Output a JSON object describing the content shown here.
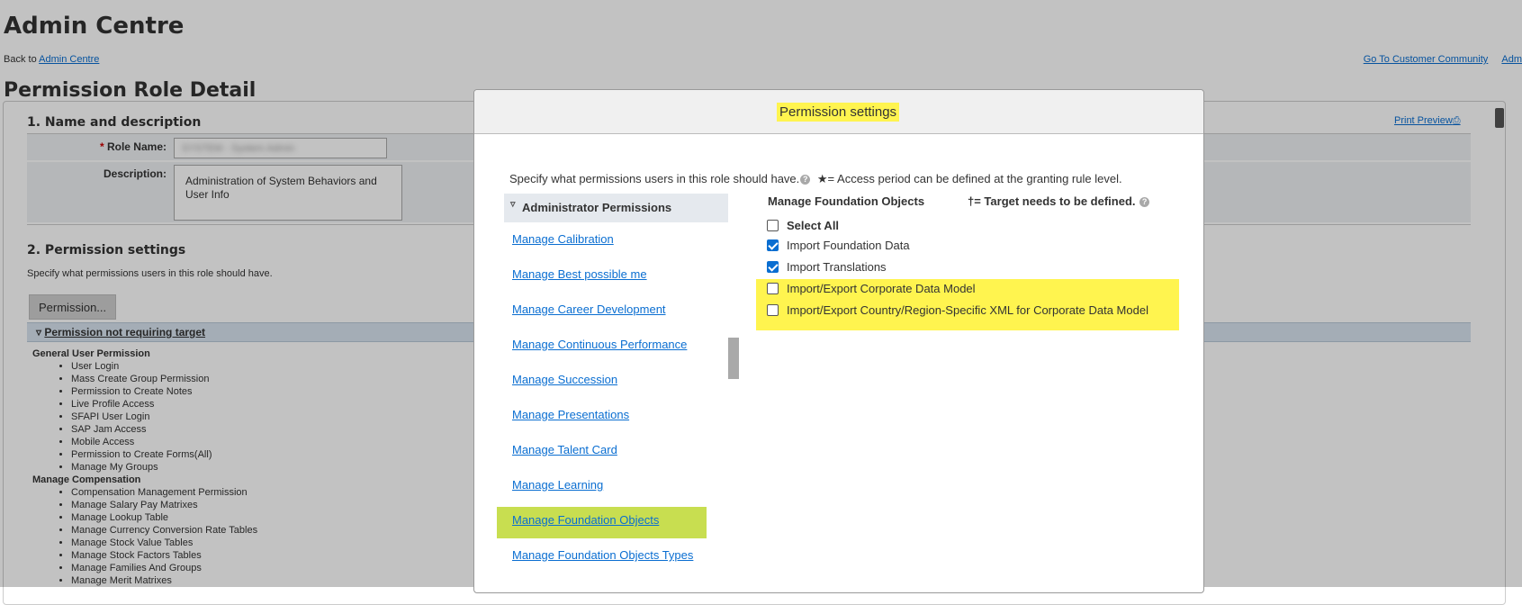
{
  "page": {
    "title": "Admin Centre",
    "back_prefix": "Back to",
    "back_link": "Admin Centre",
    "top_links": [
      "Go To Customer Community",
      "Adm"
    ],
    "detail_title": "Permission Role Detail",
    "print_preview": "Print Preview"
  },
  "section1": {
    "title": "1. Name and description",
    "role_name_label": "Role Name:",
    "role_name_value": "SYSTEM - System Admin",
    "description_label": "Description:",
    "description_value": "Administration of System Behaviors and User Info"
  },
  "section2": {
    "title": "2. Permission settings",
    "subtitle": "Specify what permissions users in this role should have.",
    "permission_button": "Permission...",
    "group_label": "Permission not requiring target",
    "categories": [
      {
        "name": "General User Permission",
        "items": [
          "User Login",
          "Mass Create Group Permission",
          "Permission to Create Notes",
          "Live Profile Access",
          "SFAPI User Login",
          "SAP Jam Access",
          "Mobile Access",
          "Permission to Create Forms(All)",
          "Manage My Groups"
        ]
      },
      {
        "name": "Manage Compensation",
        "items": [
          "Compensation Management Permission",
          "Manage Salary Pay Matrixes",
          "Manage Lookup Table",
          "Manage Currency Conversion Rate Tables",
          "Manage Stock Value Tables",
          "Manage Stock Factors Tables",
          "Manage Families And Groups",
          "Manage Merit Matrixes"
        ]
      }
    ]
  },
  "modal": {
    "title": "Permission settings",
    "intro": "Specify what permissions users in this role should have.",
    "intro_help": "?",
    "access_note": "★= Access period can be defined at the granting rule level.",
    "left_header": "Administrator Permissions",
    "left_items": [
      "Manage Calibration",
      "Manage Best possible me",
      "Manage Career Development",
      "Manage Continuous Performance",
      "Manage Succession",
      "Manage Presentations",
      "Manage Talent Card",
      "Manage Learning",
      "Manage Foundation Objects",
      "Manage Foundation Objects Types"
    ],
    "active_item_index": 8,
    "right_header": "Manage Foundation Objects",
    "target_note": "†= Target needs to be defined.",
    "target_help": "?",
    "select_all": "Select All",
    "permissions": [
      {
        "label": "Import Foundation Data",
        "checked": true
      },
      {
        "label": "Import Translations",
        "checked": true
      },
      {
        "label": "Import/Export Corporate Data Model",
        "checked": false
      },
      {
        "label": "Import/Export Country/Region-Specific XML for Corporate Data Model",
        "checked": false
      }
    ]
  },
  "colors": {
    "highlight_yellow": "#fff44f",
    "highlight_green": "#c8de50",
    "link_blue": "#0a6ed1"
  }
}
